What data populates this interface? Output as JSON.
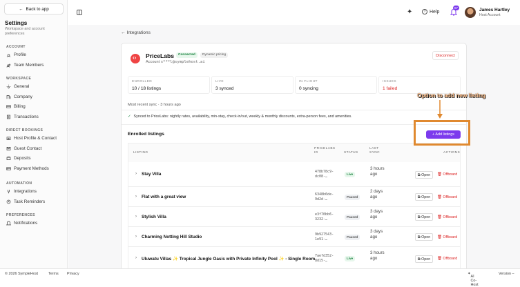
{
  "sidebar": {
    "back_label": "Back to app",
    "title": "Settings",
    "subtitle": "Workspace and account preferences",
    "sections": [
      {
        "title": "ACCOUNT",
        "items": [
          "Profile",
          "Team Members"
        ]
      },
      {
        "title": "WORKSPACE",
        "items": [
          "General",
          "Company",
          "Billing",
          "Transactions"
        ]
      },
      {
        "title": "DIRECT BOOKINGS",
        "items": [
          "Host Profile & Contact",
          "Guest Contact",
          "Deposits",
          "Payment Methods"
        ]
      },
      {
        "title": "AUTOMATION",
        "items": [
          "Integrations",
          "Task Reminders"
        ]
      },
      {
        "title": "PREFERENCES",
        "items": [
          "Notifications"
        ]
      }
    ]
  },
  "header": {
    "help_label": "Help",
    "notification_count": "87",
    "user_name": "James Hartley",
    "user_role": "Host Account"
  },
  "breadcrumb": "Integrations",
  "integration": {
    "name": "PriceLabs",
    "status_badge": "Connected",
    "mode_badge": "Dynamic pricing",
    "account_label": "Account",
    "account_value": "s***l@symplehost.ai",
    "disconnect_label": "Disconnect"
  },
  "stats": [
    {
      "label": "ENROLLED",
      "value": "10 / 18 listings"
    },
    {
      "label": "LIVE",
      "value": "3 synced"
    },
    {
      "label": "IN FLIGHT",
      "value": "0 syncing"
    },
    {
      "label": "ISSUES",
      "value": "1 failed"
    }
  ],
  "sync": {
    "recent": "Most recent sync · 3 hours ago",
    "description": "Synced to PriceLabs: nightly rates, availability, min-stay, check-in/out, weekly & monthly discounts, extra-person fees, and amenities."
  },
  "enrolled": {
    "title": "Enrolled listings",
    "add_label": "+ Add listings"
  },
  "table": {
    "headers": {
      "listing": "LISTING",
      "id": "PRICELABS ID",
      "status": "STATUS",
      "last_sync": "LAST SYNC",
      "actions": "ACTIONS"
    },
    "open_label": "Open",
    "offboard_label": "Offboard",
    "rows": [
      {
        "name": "Stay Villa",
        "id": "478b78c9-dc08-…",
        "status": "Live",
        "last_sync": "3 hours ago"
      },
      {
        "name": "Flat with a great view",
        "id": "6348b6de-9d2d-…",
        "status": "Paused",
        "last_sync": "2 days ago"
      },
      {
        "name": "Stylish Villa",
        "id": "e3f70bb6-3232-…",
        "status": "Paused",
        "last_sync": "3 days ago"
      },
      {
        "name": "Charming Notting Hill Studio",
        "id": "9b927543-1e91-…",
        "status": "Paused",
        "last_sync": "3 days ago"
      },
      {
        "name": "Uluwatu Villas ✨ Tropical Jungle Oasis with Private Infinity Pool ✨ - Single Room",
        "id": "7aefd352-8d15-…",
        "status": "Live",
        "last_sync": "3 hours ago"
      }
    ]
  },
  "annotation": {
    "text": "Option to add new listing",
    "color": "#e0892f"
  },
  "footer": {
    "copyright": "© 2026 SympleHost",
    "terms": "Terms",
    "privacy": "Privacy",
    "ai_label": "AI Co-Host",
    "version": "Version –"
  },
  "colors": {
    "accent": "#7c3aed",
    "danger": "#dc2626",
    "live": "#16803c"
  }
}
